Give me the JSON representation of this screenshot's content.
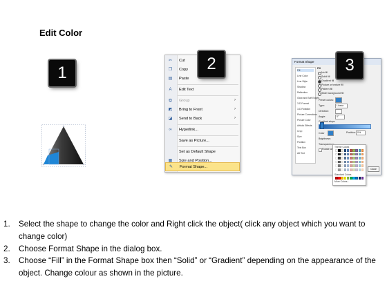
{
  "title": "Edit Color",
  "badges": [
    "1",
    "2",
    "3"
  ],
  "context_menu": {
    "items": [
      {
        "label": "Cut",
        "icon": "scissors-icon",
        "glyph": "✂",
        "disabled": false,
        "submenu": false
      },
      {
        "label": "Copy",
        "icon": "copy-icon",
        "glyph": "❐",
        "disabled": false,
        "submenu": false
      },
      {
        "label": "Paste",
        "icon": "paste-icon",
        "glyph": "📋",
        "disabled": false,
        "submenu": false
      },
      {
        "label": "Edit Text",
        "icon": "edit-text-icon",
        "glyph": "A",
        "disabled": false,
        "submenu": false
      },
      {
        "label": "Group",
        "icon": "group-icon",
        "glyph": "⧉",
        "disabled": true,
        "submenu": true
      },
      {
        "label": "Bring to Front",
        "icon": "bring-to-front-icon",
        "glyph": "◩",
        "disabled": false,
        "submenu": true
      },
      {
        "label": "Send to Back",
        "icon": "send-to-back-icon",
        "glyph": "◪",
        "disabled": false,
        "submenu": true
      },
      {
        "label": "Hyperlink...",
        "icon": "hyperlink-icon",
        "glyph": "🔗",
        "disabled": false,
        "submenu": false
      },
      {
        "label": "Save as Picture...",
        "icon": "",
        "glyph": "",
        "disabled": false,
        "submenu": false
      },
      {
        "label": "Set as Default Shape",
        "icon": "",
        "glyph": "",
        "disabled": false,
        "submenu": false
      },
      {
        "label": "Size and Position...",
        "icon": "size-position-icon",
        "glyph": "▦",
        "disabled": false,
        "submenu": false
      },
      {
        "label": "Format Shape...",
        "icon": "format-shape-icon",
        "glyph": "✎",
        "disabled": false,
        "submenu": false,
        "highlighted": true
      }
    ]
  },
  "dialog": {
    "title": "Format Shape",
    "categories": [
      "Fill",
      "Line Color",
      "Line Style",
      "Shadow",
      "Reflection",
      "Glow and Soft Edges",
      "3-D Format",
      "3-D Rotation",
      "Picture Corrections",
      "Picture Color",
      "Artistic Effects",
      "Crop",
      "Size",
      "Position",
      "Text Box",
      "Alt Text"
    ],
    "section": "Fill",
    "options": [
      "No fill",
      "Solid fill",
      "Gradient fill",
      "Picture or texture fill",
      "Pattern fill",
      "Slide background fill"
    ],
    "fields": {
      "preset": "Preset colors:",
      "type": "Type:",
      "type_value": "Linear",
      "direction": "Direction:",
      "angle": "Angle:",
      "angle_value": "0°",
      "stops": "Gradient stops",
      "color": "Color",
      "position": "Position:",
      "position_value": "0%",
      "brightness": "Brightness:",
      "transparency": "Transparency:",
      "rotate": "Rotate with shape"
    },
    "close_label": "Close",
    "palette": {
      "theme_label": "Theme Colors",
      "standard_label": "Standard Colors",
      "more_label": "More Colors..."
    }
  },
  "colors": {
    "accent_blue": "#2f7fc8",
    "pyramid_dark": "#2a2a2a",
    "menu_highlight": "#fbe38a"
  },
  "steps": [
    {
      "num": "1.",
      "text": "Select the shape to change the color and Right click the object( click any object which you want to change color)"
    },
    {
      "num": "2.",
      "text": "Choose Format Shape in the dialog box."
    },
    {
      "num": "3.",
      "text": "Choose “Fill” in the Format Shape box then “Solid” or “Gradient” depending on the appearance of the object. Change colour as shown in the picture."
    }
  ]
}
